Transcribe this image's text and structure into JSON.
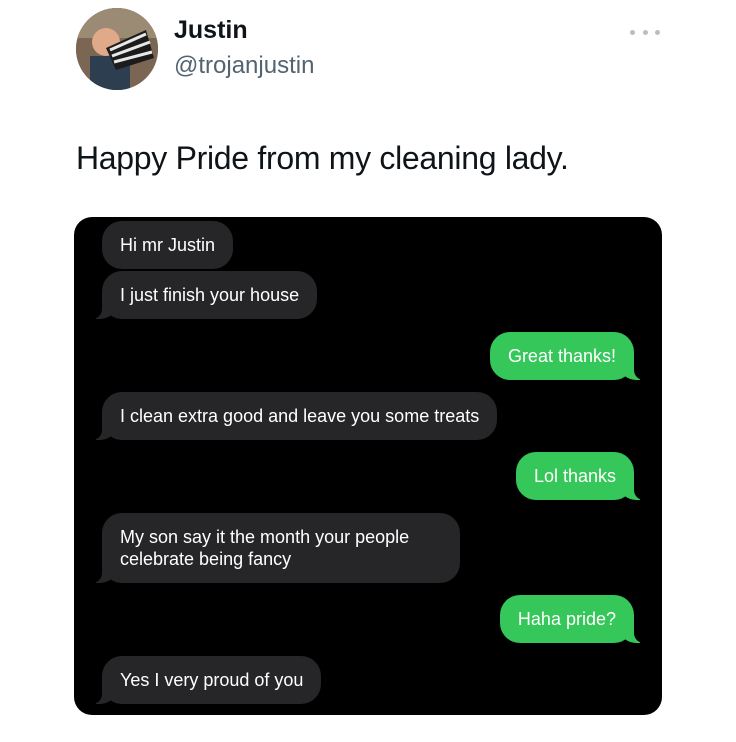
{
  "tweet": {
    "author_name": "Justin",
    "author_handle": "@trojanjustin",
    "text": "Happy Pride from my cleaning lady."
  },
  "messages": [
    {
      "side": "in",
      "text": "Hi mr Justin"
    },
    {
      "side": "in",
      "text": "I just finish your house"
    },
    {
      "side": "out",
      "text": "Great thanks!"
    },
    {
      "side": "in",
      "text": "I clean extra good and leave you some treats"
    },
    {
      "side": "out",
      "text": "Lol thanks"
    },
    {
      "side": "in",
      "text": "My son say it the month your people celebrate being fancy"
    },
    {
      "side": "out",
      "text": "Haha pride?"
    },
    {
      "side": "in",
      "text": "Yes I very proud of you"
    }
  ],
  "colors": {
    "incoming_bubble": "#262628",
    "outgoing_bubble": "#35c759",
    "chat_background": "#000000"
  }
}
